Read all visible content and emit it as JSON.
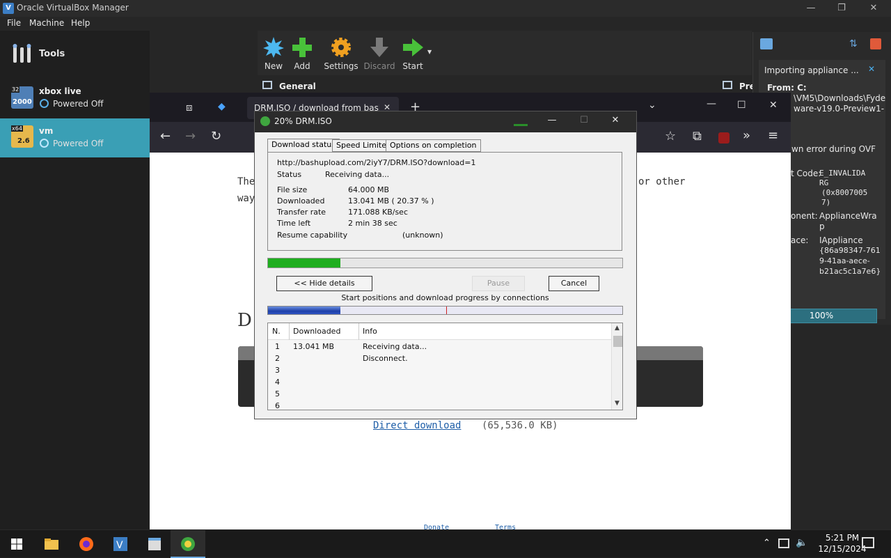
{
  "virtualbox": {
    "title": "Oracle VirtualBox Manager",
    "menu": [
      "File",
      "Machine",
      "Help"
    ],
    "tools_label": "Tools",
    "vms": [
      {
        "name": "xbox live",
        "state": "Powered Off",
        "badge": "2000",
        "badge_top": "32"
      },
      {
        "name": "vm",
        "state": "Powered Off",
        "badge": "2.6",
        "badge_top": "x64"
      }
    ],
    "toolbar": {
      "new": "New",
      "add": "Add",
      "settings": "Settings",
      "discard": "Discard",
      "start": "Start"
    },
    "details": {
      "general": "General",
      "preview": "Preview"
    }
  },
  "notification": {
    "title": "Importing appliance ...",
    "from_label": "From: C:",
    "from_path_1": "\\VM5\\Downloads\\Fyde",
    "from_path_2": "ware-v19.0-Preview1-",
    "error_text": "wn error during OVF",
    "error_code_label": "t Code:",
    "error_code_value_1": "E_INVALIDA",
    "error_code_value_2": "RG",
    "error_code_value_3": "(0x8007005",
    "error_code_value_4": "7)",
    "component_label": "onent:",
    "component_value_1": "ApplianceWra",
    "component_value_2": "p",
    "interface_label": "ace:",
    "interface_value_1": "IAppliance",
    "interface_value_2": "{86a98347-761",
    "interface_value_3": "9-41aa-aece-",
    "interface_value_4": "b21ac5c1a7e6}",
    "progress_label": "100%"
  },
  "browser": {
    "tab_title": "DRM.ISO / download from bashupload",
    "page": {
      "line1_left": "The",
      "line1_right": "or other",
      "line2_left": "way",
      "heading_fragment": "D",
      "direct_download": "Direct download",
      "size_text": "(65,536.0 KB)",
      "footer_left": "Donate",
      "footer_right": "Terms"
    }
  },
  "idm": {
    "title": "20% DRM.ISO",
    "tabs": [
      "Download status",
      "Speed Limiter",
      "Options on completion"
    ],
    "url": "http://bashupload.com/2iyY7/DRM.ISO?download=1",
    "status_label": "Status",
    "status_value": "Receiving data...",
    "file_size_label": "File size",
    "file_size_value": "64.000  MB",
    "downloaded_label": "Downloaded",
    "downloaded_value": "13.041  MB  ( 20.37 % )",
    "transfer_rate_label": "Transfer rate",
    "transfer_rate_value": "171.088  KB/sec",
    "time_left_label": "Time left",
    "time_left_value": "2 min 38 sec",
    "resume_label": "Resume capability",
    "resume_value": "(unknown)",
    "progress_percent": 20.37,
    "connection_progress_percent": 20.37,
    "buttons": {
      "hide_details": "<< Hide details",
      "pause": "Pause",
      "cancel": "Cancel"
    },
    "connections_caption": "Start positions and download progress by connections",
    "table_headers": [
      "N.",
      "Downloaded",
      "Info"
    ],
    "rows": [
      {
        "n": "1",
        "downloaded": "13.041  MB",
        "info": "Receiving data..."
      },
      {
        "n": "2",
        "downloaded": "",
        "info": "Disconnect."
      },
      {
        "n": "3",
        "downloaded": "",
        "info": ""
      },
      {
        "n": "4",
        "downloaded": "",
        "info": ""
      },
      {
        "n": "5",
        "downloaded": "",
        "info": ""
      },
      {
        "n": "6",
        "downloaded": "",
        "info": ""
      }
    ]
  },
  "taskbar": {
    "time": "5:21 PM",
    "date": "12/15/2024"
  },
  "colors": {
    "selection": "#3a9fb5",
    "idm_progress": "#1fae1f",
    "accent_blue": "#2f54c4"
  }
}
